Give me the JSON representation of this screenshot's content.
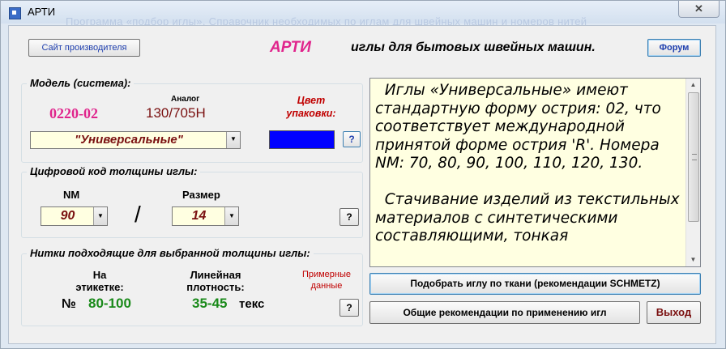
{
  "window": {
    "title": "АРТИ",
    "ghost_text": "Программа «подбор иглы». Справочник необходимых по иглам для швейных машин и номеров нитей",
    "close_symbol": "✕"
  },
  "header": {
    "manufacturer_button": "Сайт производителя",
    "brand": "АРТИ",
    "tagline": "иглы для бытовых швейных машин.",
    "forum_button": "Форум"
  },
  "model_group": {
    "legend": "Модель (система):",
    "code": "0220-02",
    "analog_label": "Аналог",
    "analog_value": "130/705H",
    "color_label": "Цвет упаковки:",
    "color_swatch": "#0000ff",
    "type_value": "\"Универсальные\"",
    "help_button": "?"
  },
  "thickness_group": {
    "legend": "Цифровой код толщины иглы:",
    "nm_label": "NM",
    "nm_value": "90",
    "separator": "/",
    "size_label": "Размер",
    "size_value": "14",
    "help_button": "?"
  },
  "threads_group": {
    "legend": "Нитки подходящие для выбранной толщины иглы:",
    "label_on": "На этикетке:",
    "density_label": "Линейная плотность:",
    "approx_label": "Примерные данные",
    "number_sign": "№",
    "number_value": "80-100",
    "density_value": "35-45",
    "density_unit": "текс",
    "help_button": "?"
  },
  "description": {
    "text": "  Иглы «Универсальные» имеют стандартную форму острия: 02, что соответствует международной принятой форме острия 'R'. Номера NM: 70, 80, 90, 100, 110, 120, 130.\n\n  Стачивание изделий из текстильных материалов с синтетическими составляющими, тонкая"
  },
  "buttons": {
    "select_by_fabric": "Подобрать иглу по ткани (рекомендации SCHMETZ)",
    "general_recommendations": "Общие рекомендации по применению игл",
    "exit": "Выход"
  }
}
